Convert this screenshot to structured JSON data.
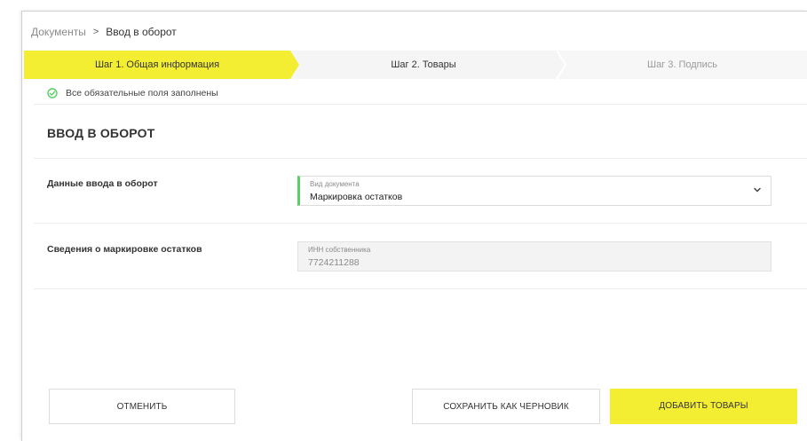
{
  "breadcrumb": {
    "parent": "Документы",
    "separator": ">",
    "current": "Ввод в оборот"
  },
  "steps": [
    {
      "label": "Шаг 1. Общая информация",
      "state": "active"
    },
    {
      "label": "Шаг 2. Товары",
      "state": "next"
    },
    {
      "label": "Шаг 3. Подпись",
      "state": "disabled"
    }
  ],
  "status": {
    "icon": "check-circle-icon",
    "text": "Все обязательные поля заполнены"
  },
  "page": {
    "title": "ВВОД В ОБОРОТ"
  },
  "sections": {
    "entry_data": {
      "label": "Данные ввода в оборот",
      "field_label": "Вид документа",
      "field_value": "Маркировка остатков"
    },
    "marking_info": {
      "label": "Сведения о маркировке остатков",
      "field_label": "ИНН собственника",
      "field_value": "7724211288"
    }
  },
  "buttons": {
    "cancel": "ОТМЕНИТЬ",
    "save_draft": "СОХРАНИТЬ КАК ЧЕРНОВИК",
    "add_goods": "ДОБАВИТЬ ТОВАРЫ"
  },
  "colors": {
    "accent_yellow": "#f4ee33",
    "success_green": "#55d064",
    "step_inactive": "#f5f5f5"
  }
}
